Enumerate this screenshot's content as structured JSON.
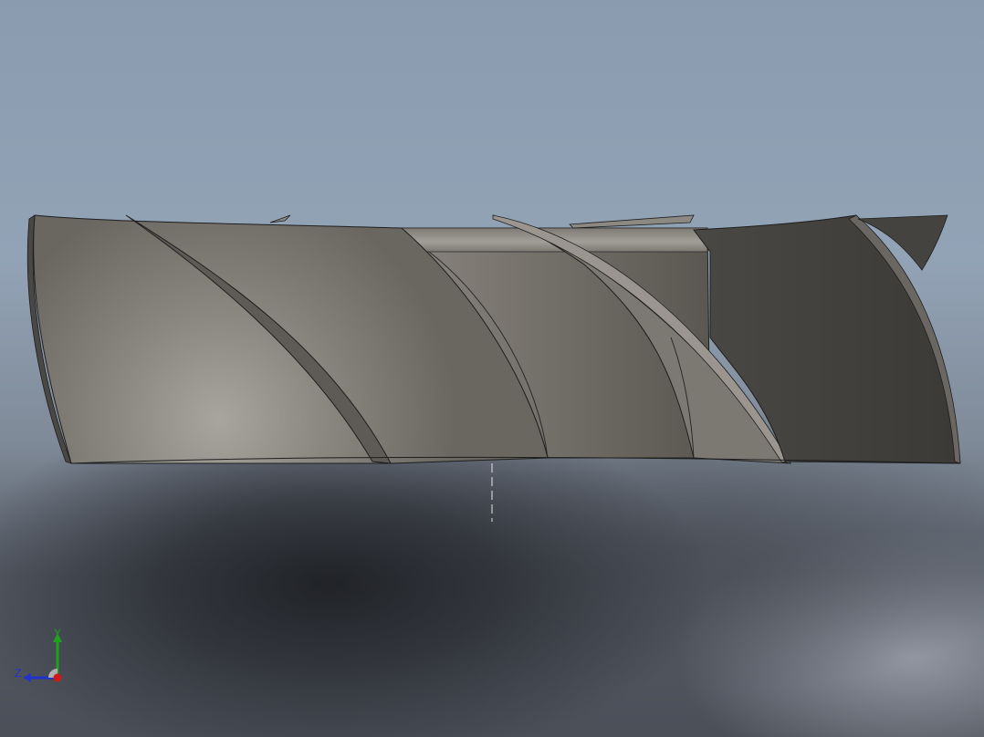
{
  "window": {
    "kind": "cad-3d-viewport"
  },
  "model": {
    "description_icon": "helical-fan-blade-model",
    "colors": {
      "surface_light": "#9e9a94",
      "surface_mid": "#7a766f",
      "surface_dark": "#4a4844",
      "edge": "#1e1e1e"
    }
  },
  "triad": {
    "y_label": "Y",
    "z_label": "Z",
    "colors": {
      "y_axis": "#1fa01f",
      "z_axis": "#2233cc",
      "x_axis": "#d01818"
    }
  }
}
